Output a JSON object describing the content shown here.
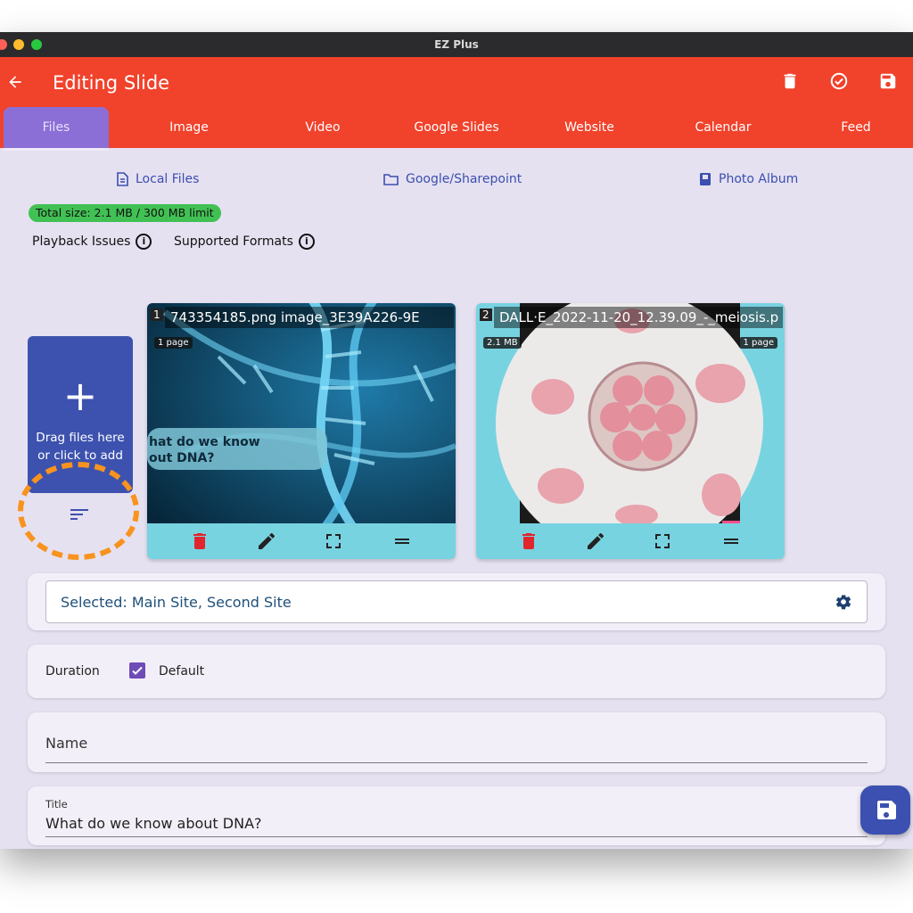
{
  "window": {
    "title": "EZ Plus"
  },
  "appbar": {
    "title": "Editing Slide"
  },
  "tabs": [
    {
      "label": "Files"
    },
    {
      "label": "Image"
    },
    {
      "label": "Video"
    },
    {
      "label": "Google Slides"
    },
    {
      "label": "Website"
    },
    {
      "label": "Calendar"
    },
    {
      "label": "Feed"
    }
  ],
  "sources": {
    "local": "Local Files",
    "google": "Google/Sharepoint",
    "album": "Photo Album"
  },
  "size_badge": "Total size: 2.1 MB / 300 MB limit",
  "help": {
    "playback": "Playback Issues",
    "formats": "Supported Formats"
  },
  "add_box": {
    "plus": "+",
    "line1": "Drag files here",
    "line2": "or click to add"
  },
  "files": [
    {
      "index": "1",
      "name": "743354185.png     image_3E39A226-9E",
      "pages": "1 page",
      "overlay_text": "hat do we know\nout DNA?"
    },
    {
      "index": "2",
      "name": "DALL·E_2022-11-20_12.39.09_-_meiosis.p",
      "size": "2.1 MB",
      "pages": "1 page"
    }
  ],
  "selected": {
    "text": "Selected: Main Site, Second Site"
  },
  "duration": {
    "label": "Duration",
    "default_label": "Default",
    "default_checked": true
  },
  "name_field": {
    "label": "Name"
  },
  "title_field": {
    "label": "Title",
    "value": "What do we know about DNA?"
  },
  "colors": {
    "appbar": "#f1422b",
    "active_tab": "#8b6fd6",
    "add_box": "#3d52ae",
    "card": "#78d3e1",
    "badge": "#41c154",
    "highlight": "#f7931e"
  },
  "icons": {
    "back": "arrow-left-icon",
    "delete": "trash-icon",
    "approve": "check-circle-icon",
    "save": "save-icon",
    "sort": "sort-icon",
    "gear": "gear-icon",
    "edit": "pencil-icon",
    "fullscreen": "fullscreen-icon",
    "drag": "drag-handle-icon"
  }
}
